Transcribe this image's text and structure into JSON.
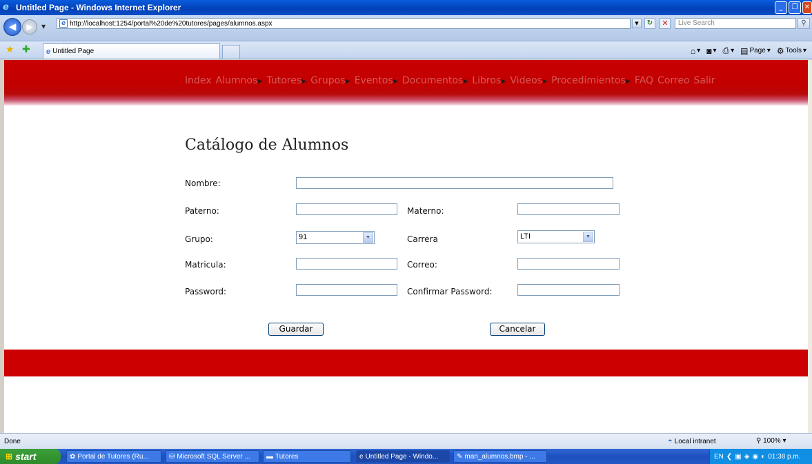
{
  "window": {
    "title": "Untitled Page - Windows Internet Explorer"
  },
  "toolbar": {
    "url": "http://localhost:1254/portal%20de%20tutores/pages/alumnos.aspx",
    "search_placeholder": "Live Search"
  },
  "tabs": {
    "active_label": "Untitled Page"
  },
  "command_bar": {
    "page_label": "Page",
    "tools_label": "Tools"
  },
  "menu": {
    "items": [
      {
        "label": "Index",
        "has_submenu": false
      },
      {
        "label": "Alumnos",
        "has_submenu": true
      },
      {
        "label": "Tutores",
        "has_submenu": true
      },
      {
        "label": "Grupos",
        "has_submenu": true
      },
      {
        "label": "Eventos",
        "has_submenu": true
      },
      {
        "label": "Documentos",
        "has_submenu": true
      },
      {
        "label": "Libros",
        "has_submenu": true
      },
      {
        "label": "Videos",
        "has_submenu": true
      },
      {
        "label": "Procedimientos",
        "has_submenu": true
      },
      {
        "label": "FAQ",
        "has_submenu": false
      },
      {
        "label": "Correo",
        "has_submenu": false
      },
      {
        "label": "Salir",
        "has_submenu": false
      }
    ]
  },
  "form": {
    "title": "Catálogo de Alumnos",
    "nombre_label": "Nombre:",
    "paterno_label": "Paterno:",
    "materno_label": "Materno:",
    "grupo_label": "Grupo:",
    "grupo_value": "91",
    "carrera_label": "Carrera",
    "carrera_value": "LTI",
    "matricula_label": "Matricula:",
    "correo_label": "Correo:",
    "password_label": "Password:",
    "confirmar_label": "Confirmar Password:",
    "save_label": "Guardar",
    "cancel_label": "Cancelar"
  },
  "status": {
    "text": "Done",
    "zone": "Local intranet",
    "zoom": "100%"
  },
  "taskbar": {
    "start_label": "start",
    "items": [
      "Portal de Tutores (Ru...",
      "Microsoft SQL Server ...",
      "Tutores",
      "Untitled Page - Windo...",
      "man_alumnos.bmp - ..."
    ],
    "lang": "EN",
    "clock": "01:38 p.m."
  },
  "colors": {
    "banner_red": "#cc0000",
    "menu_text": "#d35b5b",
    "xp_blue": "#1d4fbf"
  }
}
